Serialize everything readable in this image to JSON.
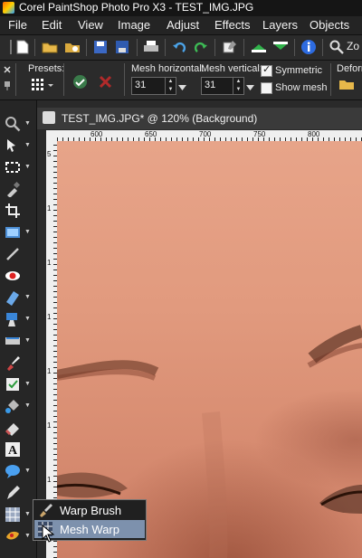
{
  "window": {
    "title": "Corel PaintShop Photo Pro X3 - TEST_IMG.JPG"
  },
  "menu": [
    "File",
    "Edit",
    "View",
    "Image",
    "Adjust",
    "Effects",
    "Layers",
    "Objects"
  ],
  "toolbar": {
    "zoom_label": "Zo"
  },
  "options": {
    "presets_label": "Presets:",
    "mesh_horizontal_label": "Mesh horizontal:",
    "mesh_horizontal_value": "31",
    "mesh_vertical_label": "Mesh vertical:",
    "mesh_vertical_value": "31",
    "symmetric_label": "Symmetric",
    "symmetric_checked": true,
    "show_mesh_label": "Show mesh",
    "show_mesh_checked": false,
    "deform_label": "Deform"
  },
  "document": {
    "title": "TEST_IMG.JPG* @ 120% (Background)",
    "ruler_h_ticks": [
      "600",
      "650",
      "700",
      "750",
      "800"
    ],
    "ruler_v_ticks": [
      "5",
      "1",
      "1",
      "1",
      "1",
      "1",
      "1",
      "1"
    ]
  },
  "flyout": {
    "items": [
      {
        "label": "Warp Brush",
        "selected": false
      },
      {
        "label": "Mesh Warp",
        "selected": true
      }
    ]
  },
  "colors": {
    "accent_selection": "#7d91ad",
    "skin": "#e19a7e"
  }
}
